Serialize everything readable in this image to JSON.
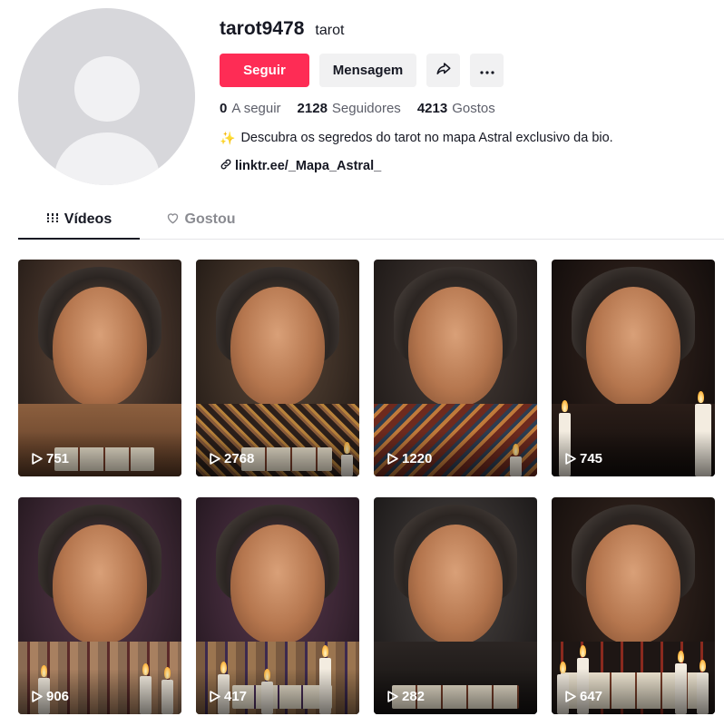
{
  "profile": {
    "username": "tarot9478",
    "nickname": "tarot",
    "follow_label": "Seguir",
    "message_label": "Mensagem",
    "share_icon": "share-icon",
    "more_icon": "more-icon",
    "following_count": "0",
    "following_label": "A seguir",
    "followers_count": "2128",
    "followers_label": "Seguidores",
    "likes_count": "4213",
    "likes_label": "Gostos",
    "bio_emoji": "✨",
    "bio": "Descubra os segredos do tarot no mapa Astral exclusivo da bio.",
    "link": "linktr.ee/_Mapa_Astral_"
  },
  "tabs": [
    {
      "label": "Vídeos",
      "icon": "grid-bars-icon",
      "active": true
    },
    {
      "label": "Gostou",
      "icon": "heart-outline-icon",
      "active": false
    }
  ],
  "videos": [
    {
      "views": "751"
    },
    {
      "views": "2768"
    },
    {
      "views": "1220"
    },
    {
      "views": "745"
    },
    {
      "views": "906"
    },
    {
      "views": "417"
    },
    {
      "views": "282"
    },
    {
      "views": "647"
    }
  ],
  "colors": {
    "accent": "#fe2c55",
    "text": "#161823",
    "muted": "#5c5e69"
  }
}
